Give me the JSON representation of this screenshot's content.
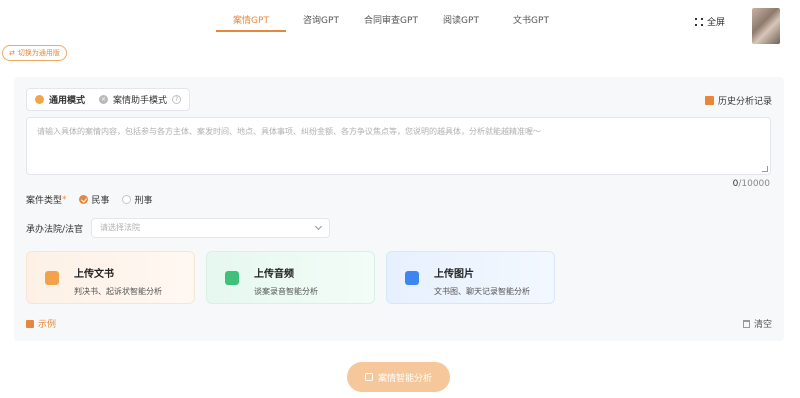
{
  "nav": {
    "tabs": [
      "案情GPT",
      "咨询GPT",
      "合同审查GPT",
      "阅读GPT",
      "文书GPT"
    ],
    "active_tab_index": 0,
    "fullscreen_label": "全屏",
    "accent_color": "#e8873c"
  },
  "switch_label": "切换为通用版",
  "modes": {
    "general": "通用模式",
    "assistant": "案情助手模式"
  },
  "history_label": "历史分析记录",
  "input": {
    "placeholder": "请输入具体的案情内容，包括参与各方主体、案发时间、地点、具体事项、纠纷金额、各方争议焦点等，您说明的越具体，分析就能越精准喔～",
    "count": "0",
    "max": "/10000"
  },
  "case_type": {
    "label": "案件类型",
    "required_mark": "*",
    "options": [
      "民事",
      "刑事"
    ],
    "selected": "民事"
  },
  "court": {
    "label": "承办法院/法官",
    "placeholder": "请选择法院"
  },
  "uploads": [
    {
      "title": "上传文书",
      "subtitle": "判决书、起诉状智能分析",
      "icon": "document-upload-icon"
    },
    {
      "title": "上传音频",
      "subtitle": "谈案录音智能分析",
      "icon": "audio-upload-icon"
    },
    {
      "title": "上传图片",
      "subtitle": "文书图、聊天记录智能分析",
      "icon": "image-upload-icon"
    }
  ],
  "example_label": "示例",
  "clear_label": "清空",
  "submit_label": "案情智能分析"
}
